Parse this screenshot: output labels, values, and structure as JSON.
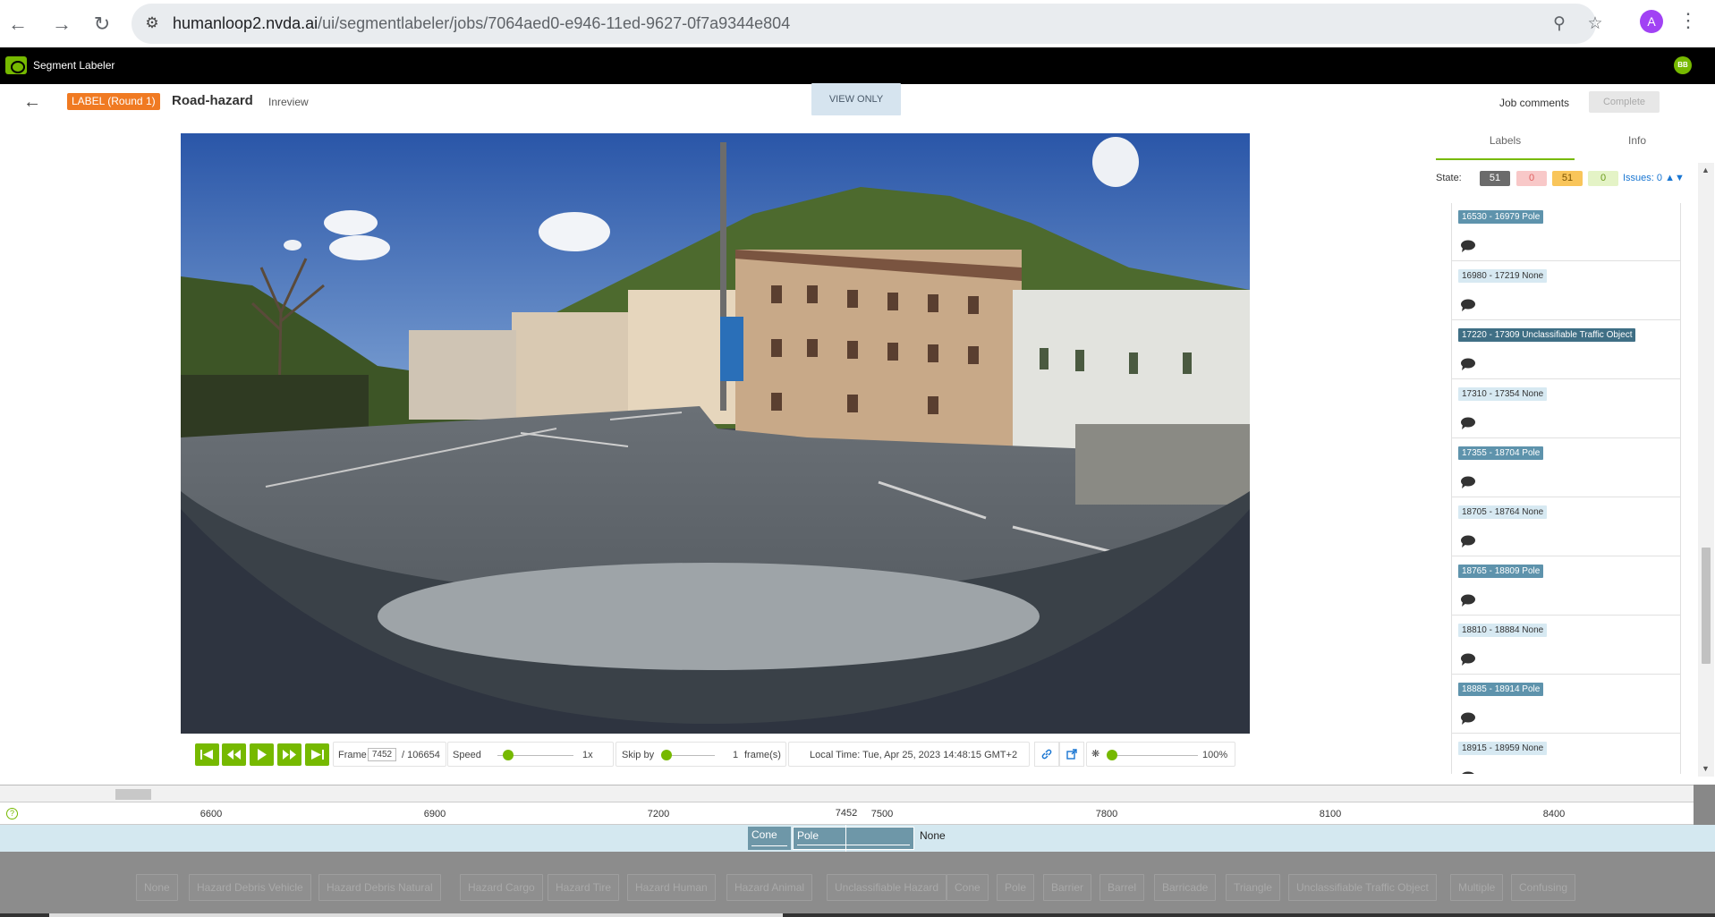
{
  "browser": {
    "url_host": "humanloop2.nvda.ai",
    "url_path": "/ui/segmentlabeler/jobs/7064aed0-e946-11ed-9627-0f7a9344e804",
    "profile_initial": "A"
  },
  "app": {
    "title": "Segment Labeler",
    "user_badge": "BB"
  },
  "job": {
    "label_badge": "LABEL (Round 1)",
    "title": "Road-hazard",
    "status": "Inreview",
    "view_only": "VIEW ONLY",
    "job_comments": "Job comments",
    "complete": "Complete"
  },
  "player": {
    "frame_label": "Frame",
    "frame_value": "7452",
    "frame_total": "/ 106654",
    "speed_label": "Speed",
    "speed_value": "1x",
    "speed_level": 0.1,
    "skip_label": "Skip by",
    "skip_value": "1",
    "skip_unit": "frame(s)",
    "local_time": "Local Time: Tue, Apr 25, 2023 14:48:15 GMT+2",
    "brightness_value": "100%",
    "brightness_level": 0.0
  },
  "panel": {
    "tabs": [
      "Labels",
      "Info"
    ],
    "state_label": "State:",
    "state_counts": [
      {
        "value": "51",
        "bg": "#6b6b6b",
        "fg": "#ffffff"
      },
      {
        "value": "0",
        "bg": "#f8c8c8",
        "fg": "#e06060"
      },
      {
        "value": "51",
        "bg": "#f9c55a",
        "fg": "#7a5200"
      },
      {
        "value": "0",
        "bg": "#e4f3c6",
        "fg": "#6a9a1a"
      }
    ],
    "issues": "Issues: 0",
    "labels": [
      {
        "text": "16530 - 16979 Pole",
        "kind": "pole"
      },
      {
        "text": "16980 - 17219 None",
        "kind": "none"
      },
      {
        "text": "17220 - 17309 Unclassifiable Traffic Object",
        "kind": "uto"
      },
      {
        "text": "17310 - 17354 None",
        "kind": "none"
      },
      {
        "text": "17355 - 18704 Pole",
        "kind": "pole"
      },
      {
        "text": "18705 - 18764 None",
        "kind": "none"
      },
      {
        "text": "18765 - 18809 Pole",
        "kind": "pole"
      },
      {
        "text": "18810 - 18884 None",
        "kind": "none"
      },
      {
        "text": "18885 - 18914 Pole",
        "kind": "pole"
      },
      {
        "text": "18915 - 18959 None",
        "kind": "none"
      }
    ]
  },
  "timeline": {
    "ticks": [
      "6600",
      "6900",
      "7200",
      "7500",
      "7800",
      "8100",
      "8400"
    ],
    "current_frame": "7452",
    "segments": [
      "Cone",
      "Pole",
      "None"
    ]
  },
  "classes": [
    "None",
    "Hazard Debris Vehicle",
    "Hazard Debris Natural",
    "Hazard Cargo",
    "Hazard Tire",
    "Hazard Human",
    "Hazard Animal",
    "Unclassifiable Hazard",
    "Cone",
    "Pole",
    "Barrier",
    "Barrel",
    "Barricade",
    "Triangle",
    "Unclassifiable Traffic Object",
    "Multiple",
    "Confusing"
  ],
  "colors": {
    "accent": "#76b900",
    "label_orange": "#f07a22",
    "segment_blue": "#6e97a8"
  }
}
